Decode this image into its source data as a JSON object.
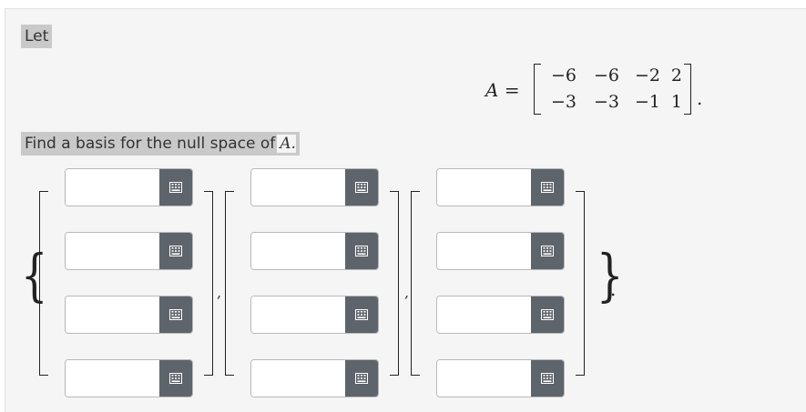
{
  "intro": "Let",
  "matrix_a": {
    "name": "A",
    "equals": "=",
    "rows": [
      [
        "−6",
        "−6",
        "−2",
        "2"
      ],
      [
        "−3",
        "−3",
        "−1",
        "1"
      ]
    ],
    "trailing": "."
  },
  "question": {
    "text": "Find a basis for the null space of",
    "math": "A."
  },
  "answer": {
    "open_brace": "{",
    "close_brace": "}",
    "separator": ",",
    "trailing": ".",
    "vectors": [
      {
        "entries": [
          "",
          "",
          "",
          ""
        ]
      },
      {
        "entries": [
          "",
          "",
          "",
          ""
        ]
      },
      {
        "entries": [
          "",
          "",
          "",
          ""
        ]
      }
    ],
    "keypad_icon": "keypad-icon",
    "keypad_button_color": "#5e646b"
  }
}
